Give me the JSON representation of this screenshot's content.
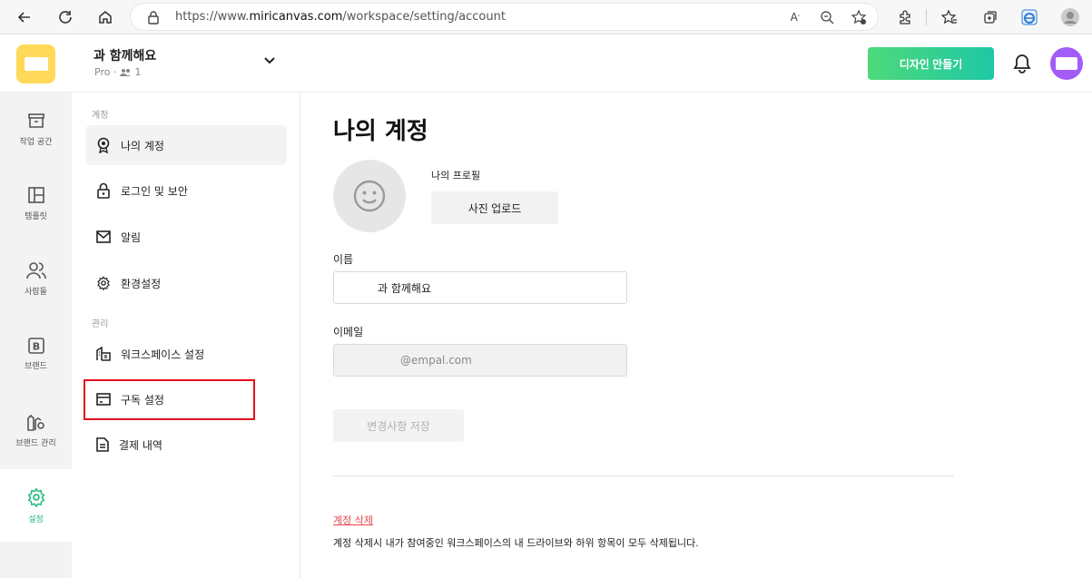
{
  "browser": {
    "url_prefix": "https://www.",
    "url_host": "miricanvas.com",
    "url_path": "/workspace/setting/account"
  },
  "header": {
    "workspace_name": "과 함께해요",
    "plan": "Pro ·",
    "member_count": "1",
    "create_button": "디자인 만들기"
  },
  "rail": {
    "items": [
      {
        "label": "작업 공간",
        "icon": "archive-icon"
      },
      {
        "label": "템플릿",
        "icon": "template-grid-icon"
      },
      {
        "label": "사람들",
        "icon": "people-icon"
      },
      {
        "label": "브랜드",
        "icon": "brand-b-icon"
      },
      {
        "label": "브랜드 관리",
        "icon": "brand-manage-icon"
      },
      {
        "label": "설정",
        "icon": "gear-icon",
        "active": true
      }
    ],
    "active_color": "#1bb77a"
  },
  "menu": {
    "section_account": "계정",
    "section_manage": "관리",
    "items": [
      {
        "label": "나의 계정",
        "icon": "account-badge-icon",
        "active": true
      },
      {
        "label": "로그인 및 보안",
        "icon": "lock-icon"
      },
      {
        "label": "알림",
        "icon": "mail-icon"
      },
      {
        "label": "환경설정",
        "icon": "gear-icon"
      },
      {
        "label": "워크스페이스 설정",
        "icon": "workspace-icon"
      },
      {
        "label": "구독 설정",
        "icon": "card-icon"
      },
      {
        "label": "결제 내역",
        "icon": "document-icon"
      }
    ]
  },
  "main": {
    "title": "나의 계정",
    "profile_label": "나의 프로필",
    "upload_button": "사진 업로드",
    "name_label": "이름",
    "name_value": "과 함께해요",
    "email_label": "이메일",
    "email_value": "@empal.com",
    "save_button": "변경사항 저장",
    "delete_link": "계정 삭제",
    "delete_description": "계정 삭제시 내가 참여중인 워크스페이스의 내 드라이브와 하위 항목이 모두 삭제됩니다."
  },
  "colors": {
    "logo": "#ffd95a",
    "avatar": "#a25cf7",
    "create_gradient_start": "#4ed97a",
    "create_gradient_end": "#1ec8a4",
    "highlight_box": "#e3101c",
    "delete_link": "#e5484d"
  }
}
